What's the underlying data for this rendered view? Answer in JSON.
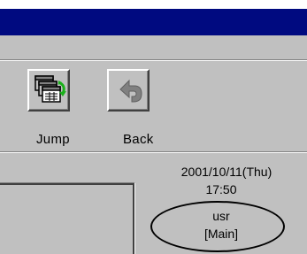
{
  "toolbar": {
    "jump_label": "Jump",
    "back_label": "Back"
  },
  "status": {
    "date": "2001/10/11(Thu)",
    "time": "17:50",
    "user": "usr",
    "mode": "[Main]"
  },
  "icons": {
    "jump": "jump-windows-icon",
    "back": "back-arrow-icon"
  },
  "colors": {
    "title_bar": "#000a80",
    "face": "#c0c0c0",
    "jump_arrow": "#1ab01a"
  }
}
